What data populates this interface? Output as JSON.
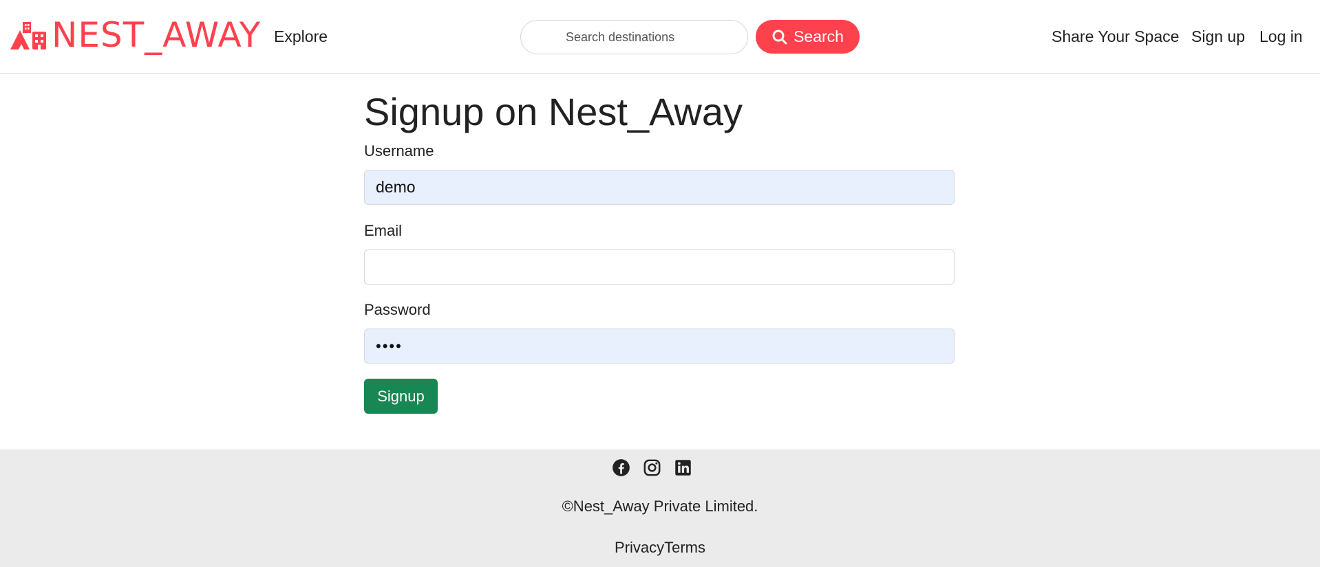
{
  "brand": {
    "name": "NEST_AWAY",
    "icon": "city-buildings-icon",
    "color": "#fe424d"
  },
  "nav": {
    "explore": "Explore",
    "search_placeholder": "Search destinations",
    "search_button": "Search",
    "search_icon": "search-icon",
    "share_space": "Share Your Space",
    "signup": "Sign up",
    "login": "Log in"
  },
  "form": {
    "title": "Signup on Nest_Away",
    "username_label": "Username",
    "username_value": "demo",
    "email_label": "Email",
    "email_value": "",
    "password_label": "Password",
    "password_value": "demo",
    "submit_label": "Signup",
    "submit_color": "#198754"
  },
  "footer": {
    "social_icons": [
      "facebook-icon",
      "instagram-icon",
      "linkedin-icon"
    ],
    "copyright": "©Nest_Away Private Limited.",
    "privacy": "Privacy",
    "terms": "Terms"
  }
}
